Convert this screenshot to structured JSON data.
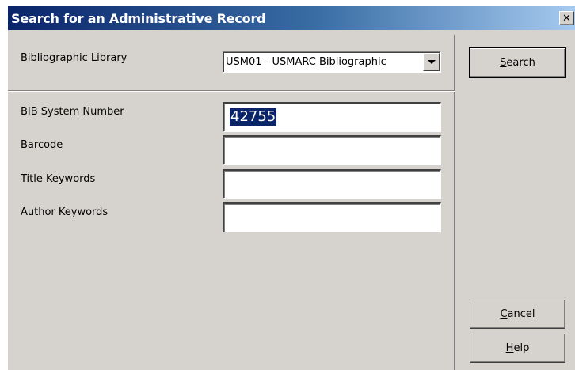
{
  "window": {
    "title": "Search for an Administrative Record",
    "close_glyph": "✕"
  },
  "library": {
    "label": "Bibliographic Library",
    "selected": "USM01 - USMARC Bibliographic"
  },
  "fields": {
    "bib_label": "BIB System Number",
    "bib_value": "42755",
    "barcode_label": "Barcode",
    "barcode_value": "",
    "title_label": "Title Keywords",
    "title_value": "",
    "author_label": "Author Keywords",
    "author_value": ""
  },
  "buttons": {
    "search_key": "S",
    "search_rest": "earch",
    "cancel_key": "C",
    "cancel_rest": "ancel",
    "help_key": "H",
    "help_rest": "elp"
  }
}
